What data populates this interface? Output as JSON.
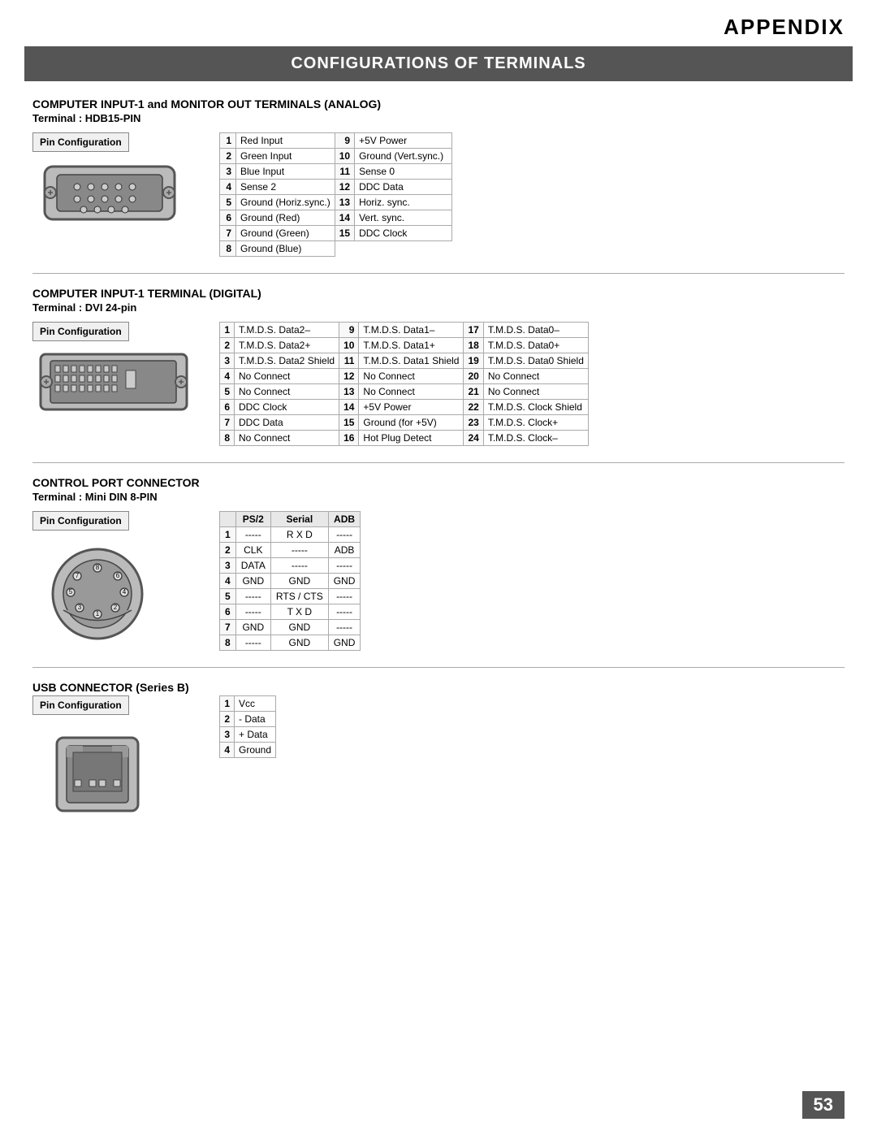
{
  "header": {
    "title": "APPENDIX"
  },
  "main_title": "CONFIGURATIONS OF TERMINALS",
  "page_number": "53",
  "sections": {
    "analog": {
      "title": "COMPUTER INPUT-1 and MONITOR OUT TERMINALS (ANALOG)",
      "subtitle": "Terminal : HDB15-PIN",
      "pin_config_label": "Pin Configuration",
      "pins_left": [
        {
          "num": "1",
          "desc": "Red Input"
        },
        {
          "num": "2",
          "desc": "Green Input"
        },
        {
          "num": "3",
          "desc": "Blue Input"
        },
        {
          "num": "4",
          "desc": "Sense 2"
        },
        {
          "num": "5",
          "desc": "Ground (Horiz.sync.)"
        },
        {
          "num": "6",
          "desc": "Ground (Red)"
        },
        {
          "num": "7",
          "desc": "Ground (Green)"
        },
        {
          "num": "8",
          "desc": "Ground (Blue)"
        }
      ],
      "pins_right": [
        {
          "num": "9",
          "desc": "+5V Power"
        },
        {
          "num": "10",
          "desc": "Ground (Vert.sync.)"
        },
        {
          "num": "11",
          "desc": "Sense 0"
        },
        {
          "num": "12",
          "desc": "DDC Data"
        },
        {
          "num": "13",
          "desc": "Horiz. sync."
        },
        {
          "num": "14",
          "desc": "Vert. sync."
        },
        {
          "num": "15",
          "desc": "DDC Clock"
        }
      ]
    },
    "digital": {
      "title": "COMPUTER INPUT-1 TERMINAL (DIGITAL)",
      "subtitle": "Terminal : DVI 24-pin",
      "pin_config_label": "Pin Configuration",
      "pins_col1": [
        {
          "num": "1",
          "desc": "T.M.D.S. Data2–"
        },
        {
          "num": "2",
          "desc": "T.M.D.S. Data2+"
        },
        {
          "num": "3",
          "desc": "T.M.D.S. Data2 Shield"
        },
        {
          "num": "4",
          "desc": "No Connect"
        },
        {
          "num": "5",
          "desc": "No Connect"
        },
        {
          "num": "6",
          "desc": "DDC Clock"
        },
        {
          "num": "7",
          "desc": "DDC Data"
        },
        {
          "num": "8",
          "desc": "No Connect"
        }
      ],
      "pins_col2": [
        {
          "num": "9",
          "desc": "T.M.D.S. Data1–"
        },
        {
          "num": "10",
          "desc": "T.M.D.S. Data1+"
        },
        {
          "num": "11",
          "desc": "T.M.D.S. Data1 Shield"
        },
        {
          "num": "12",
          "desc": "No Connect"
        },
        {
          "num": "13",
          "desc": "No Connect"
        },
        {
          "num": "14",
          "desc": "+5V Power"
        },
        {
          "num": "15",
          "desc": "Ground (for +5V)"
        },
        {
          "num": "16",
          "desc": "Hot Plug Detect"
        }
      ],
      "pins_col3": [
        {
          "num": "17",
          "desc": "T.M.D.S. Data0–"
        },
        {
          "num": "18",
          "desc": "T.M.D.S. Data0+"
        },
        {
          "num": "19",
          "desc": "T.M.D.S. Data0 Shield"
        },
        {
          "num": "20",
          "desc": "No Connect"
        },
        {
          "num": "21",
          "desc": "No Connect"
        },
        {
          "num": "22",
          "desc": "T.M.D.S. Clock Shield"
        },
        {
          "num": "23",
          "desc": "T.M.D.S. Clock+"
        },
        {
          "num": "24",
          "desc": "T.M.D.S. Clock–"
        }
      ]
    },
    "control": {
      "title": "CONTROL PORT CONNECTOR",
      "subtitle": "Terminal : Mini DIN 8-PIN",
      "pin_config_label": "Pin Configuration",
      "col_headers": [
        "",
        "PS/2",
        "Serial",
        "ADB"
      ],
      "rows": [
        {
          "num": "1",
          "ps2": "-----",
          "serial": "R X D",
          "adb": "-----"
        },
        {
          "num": "2",
          "ps2": "CLK",
          "serial": "-----",
          "adb": "ADB"
        },
        {
          "num": "3",
          "ps2": "DATA",
          "serial": "-----",
          "adb": "-----"
        },
        {
          "num": "4",
          "ps2": "GND",
          "serial": "GND",
          "adb": "GND"
        },
        {
          "num": "5",
          "ps2": "-----",
          "serial": "RTS / CTS",
          "adb": "-----"
        },
        {
          "num": "6",
          "ps2": "-----",
          "serial": "T X D",
          "adb": "-----"
        },
        {
          "num": "7",
          "ps2": "GND",
          "serial": "GND",
          "adb": "-----"
        },
        {
          "num": "8",
          "ps2": "-----",
          "serial": "GND",
          "adb": "GND"
        }
      ]
    },
    "usb": {
      "title": "USB CONNECTOR (Series B)",
      "pin_config_label": "Pin Configuration",
      "rows": [
        {
          "num": "1",
          "desc": "Vcc"
        },
        {
          "num": "2",
          "desc": "- Data"
        },
        {
          "num": "3",
          "desc": "+ Data"
        },
        {
          "num": "4",
          "desc": "Ground"
        }
      ]
    }
  }
}
